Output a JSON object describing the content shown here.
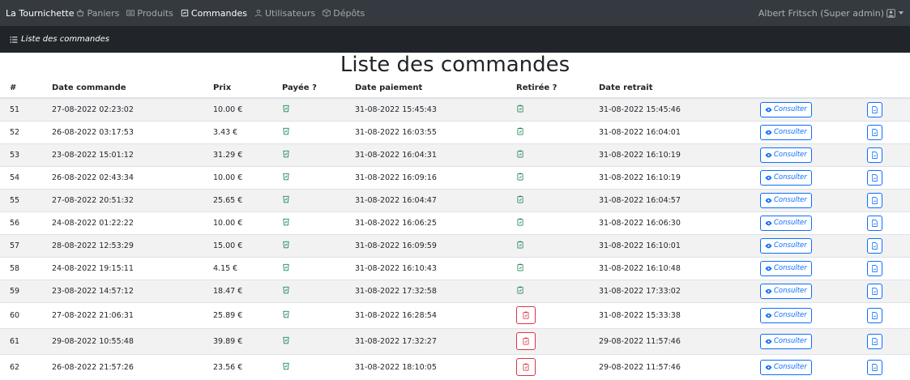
{
  "navbar": {
    "brand": "La Tournichette",
    "items": [
      {
        "label": "Paniers",
        "icon": "basket-icon",
        "active": false
      },
      {
        "label": "Produits",
        "icon": "list-icon",
        "active": false
      },
      {
        "label": "Commandes",
        "icon": "receipt-icon",
        "active": true
      },
      {
        "label": "Utilisateurs",
        "icon": "user-icon",
        "active": false
      },
      {
        "label": "Dépôts",
        "icon": "box-icon",
        "active": false
      }
    ],
    "user": "Albert Fritsch (Super admin)"
  },
  "subbar": {
    "title": "Liste des commandes"
  },
  "page": {
    "title": "Liste des commandes"
  },
  "table": {
    "headers": [
      "#",
      "Date commande",
      "Prix",
      "Payée ?",
      "Date paiement",
      "Retirée ?",
      "Date retrait"
    ],
    "consult_label": "Consulter",
    "rows": [
      {
        "id": "51",
        "date": "27-08-2022 02:23:02",
        "price": "10.00 €",
        "paid": true,
        "pay_date": "31-08-2022 15:45:43",
        "withdrawn": true,
        "withdraw_date": "31-08-2022 15:45:46"
      },
      {
        "id": "52",
        "date": "26-08-2022 03:17:53",
        "price": "3.43 €",
        "paid": true,
        "pay_date": "31-08-2022 16:03:55",
        "withdrawn": true,
        "withdraw_date": "31-08-2022 16:04:01"
      },
      {
        "id": "53",
        "date": "23-08-2022 15:01:12",
        "price": "31.29 €",
        "paid": true,
        "pay_date": "31-08-2022 16:04:31",
        "withdrawn": true,
        "withdraw_date": "31-08-2022 16:10:19"
      },
      {
        "id": "54",
        "date": "26-08-2022 02:43:34",
        "price": "10.00 €",
        "paid": true,
        "pay_date": "31-08-2022 16:09:16",
        "withdrawn": true,
        "withdraw_date": "31-08-2022 16:10:19"
      },
      {
        "id": "55",
        "date": "27-08-2022 20:51:32",
        "price": "25.65 €",
        "paid": true,
        "pay_date": "31-08-2022 16:04:47",
        "withdrawn": true,
        "withdraw_date": "31-08-2022 16:04:57"
      },
      {
        "id": "56",
        "date": "24-08-2022 01:22:22",
        "price": "10.00 €",
        "paid": true,
        "pay_date": "31-08-2022 16:06:25",
        "withdrawn": true,
        "withdraw_date": "31-08-2022 16:06:30"
      },
      {
        "id": "57",
        "date": "28-08-2022 12:53:29",
        "price": "15.00 €",
        "paid": true,
        "pay_date": "31-08-2022 16:09:59",
        "withdrawn": true,
        "withdraw_date": "31-08-2022 16:10:01"
      },
      {
        "id": "58",
        "date": "24-08-2022 19:15:11",
        "price": "4.15 €",
        "paid": true,
        "pay_date": "31-08-2022 16:10:43",
        "withdrawn": true,
        "withdraw_date": "31-08-2022 16:10:48"
      },
      {
        "id": "59",
        "date": "23-08-2022 14:57:12",
        "price": "18.47 €",
        "paid": true,
        "pay_date": "31-08-2022 17:32:58",
        "withdrawn": true,
        "withdraw_date": "31-08-2022 17:33:02"
      },
      {
        "id": "60",
        "date": "27-08-2022 21:06:31",
        "price": "25.89 €",
        "paid": true,
        "pay_date": "31-08-2022 16:28:54",
        "withdrawn": false,
        "withdraw_date": "31-08-2022 15:33:38"
      },
      {
        "id": "61",
        "date": "29-08-2022 10:55:48",
        "price": "39.89 €",
        "paid": true,
        "pay_date": "31-08-2022 17:32:27",
        "withdrawn": false,
        "withdraw_date": "29-08-2022 11:57:46"
      },
      {
        "id": "62",
        "date": "26-08-2022 21:57:26",
        "price": "23.56 €",
        "paid": true,
        "pay_date": "31-08-2022 18:10:05",
        "withdrawn": false,
        "withdraw_date": "29-08-2022 11:57:46"
      }
    ]
  },
  "colors": {
    "green": "#198754",
    "blue": "#0d6efd",
    "red": "#dc3545",
    "navbar": "#343a40",
    "subbar": "#212529"
  }
}
